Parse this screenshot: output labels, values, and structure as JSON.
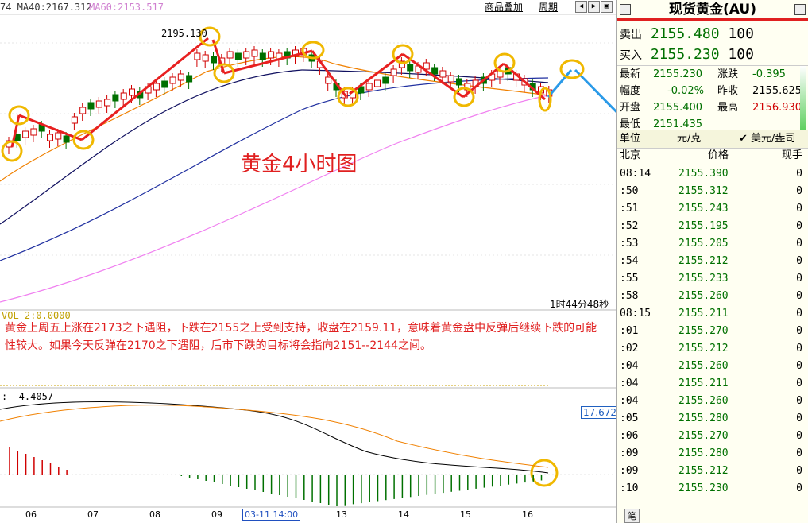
{
  "topbar": {
    "ma40": "74 MA40:2167.312",
    "ma60": "MA60:2153.517",
    "overlay_btn": "商品叠加",
    "period_btn": "周期"
  },
  "chart": {
    "annotation_title": "黄金4小时图",
    "high_marker": "2195.130",
    "timer": "1时44分48秒",
    "vol_label": "VOL 2:0.0000",
    "commentary": "黄金上周五上涨在2173之下遇阻，下跌在2155之上受到支持，收盘在2159.11，意味着黄金盘中反弹后继续下跌的可能性较大。如果今天反弹在2170之下遇阻，后市下跌的目标将会指向2151--2144之间。",
    "macd_label": ": -4.4057",
    "macd_value": "17.672",
    "x_labels": [
      "06",
      "07",
      "08",
      "09",
      "13",
      "14",
      "15",
      "16"
    ],
    "x_selected": "03-11 14:00",
    "up_color": "#d00000",
    "down_color": "#007000"
  },
  "panel": {
    "title": "现货黄金(AU)",
    "sell_label": "卖出",
    "sell_price": "2155.480",
    "sell_qty": "100",
    "buy_label": "买入",
    "buy_price": "2155.230",
    "buy_qty": "100",
    "stats": {
      "latest_label": "最新",
      "latest": "2155.230",
      "change_label": "涨跌",
      "change": "-0.395",
      "range_label": "幅度",
      "range": "-0.02%",
      "prevclose_label": "昨收",
      "prevclose": "2155.625",
      "open_label": "开盘",
      "open": "2155.400",
      "high_label": "最高",
      "high": "2156.930",
      "low_label": "最低",
      "low": "2151.435"
    },
    "unit_label": "单位",
    "unit_value": "元/克",
    "unit_alt": "✔ 美元/盎司",
    "hdr_time": "北京",
    "hdr_price": "价格",
    "hdr_vol": "现手",
    "ticks": [
      {
        "t": "08:14",
        "p": "2155.390",
        "v": "0"
      },
      {
        "t": ":50",
        "p": "2155.312",
        "v": "0"
      },
      {
        "t": ":51",
        "p": "2155.243",
        "v": "0"
      },
      {
        "t": ":52",
        "p": "2155.195",
        "v": "0"
      },
      {
        "t": ":53",
        "p": "2155.205",
        "v": "0"
      },
      {
        "t": ":54",
        "p": "2155.212",
        "v": "0"
      },
      {
        "t": ":55",
        "p": "2155.233",
        "v": "0"
      },
      {
        "t": ":58",
        "p": "2155.260",
        "v": "0"
      },
      {
        "t": "08:15",
        "p": "2155.211",
        "v": "0"
      },
      {
        "t": ":01",
        "p": "2155.270",
        "v": "0"
      },
      {
        "t": ":02",
        "p": "2155.212",
        "v": "0"
      },
      {
        "t": ":04",
        "p": "2155.260",
        "v": "0"
      },
      {
        "t": ":04",
        "p": "2155.211",
        "v": "0"
      },
      {
        "t": ":04",
        "p": "2155.260",
        "v": "0"
      },
      {
        "t": ":05",
        "p": "2155.280",
        "v": "0"
      },
      {
        "t": ":06",
        "p": "2155.270",
        "v": "0"
      },
      {
        "t": ":09",
        "p": "2155.280",
        "v": "0"
      },
      {
        "t": ":09",
        "p": "2155.212",
        "v": "0"
      },
      {
        "t": ":10",
        "p": "2155.230",
        "v": "0"
      }
    ],
    "footer": "笔"
  }
}
